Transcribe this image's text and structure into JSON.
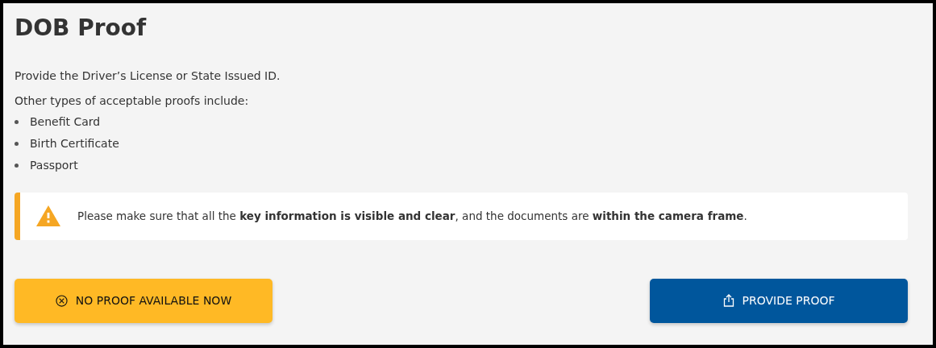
{
  "title": "DOB Proof",
  "intro": "Provide the Driver’s License or State Issued ID.",
  "list_heading": "Other types of acceptable proofs include:",
  "proofs": [
    "Benefit Card",
    "Birth Certificate",
    "Passport"
  ],
  "alert": {
    "kind": "warning",
    "text": "Please make sure that all the **key information is visible and clear**, and the documents are **within the camera frame**."
  },
  "buttons": [
    {
      "kind": "decline",
      "label": "NO PROOF AVAILABLE NOW"
    },
    {
      "kind": "submit",
      "label": "PROVIDE PROOF"
    }
  ]
}
